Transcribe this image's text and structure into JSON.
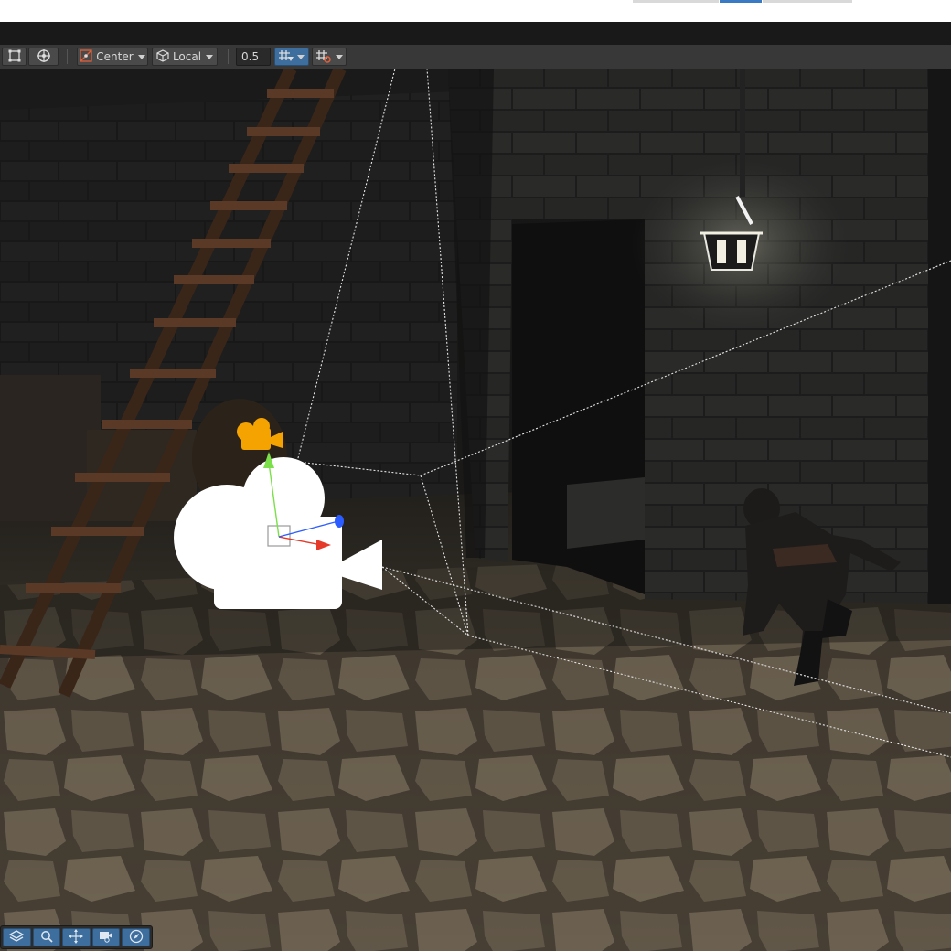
{
  "toolbar": {
    "pivot_label": "Center",
    "space_label": "Local",
    "snap_value": "0.5"
  },
  "icons": {
    "rect_tool": "rect-tool-icon",
    "transform_tool": "transform-tool-icon",
    "pivot": "pivot-icon",
    "local": "local-space-icon",
    "grid_snap": "grid-snap-icon",
    "increment_snap": "increment-snap-icon"
  },
  "overlay": [
    "layers-icon",
    "search-icon",
    "move-icon",
    "camera-preview-icon",
    "compass-icon"
  ],
  "colors": {
    "toolbar_bg": "#383838",
    "accent_blue": "#3d6e9e",
    "camera_gizmo": "#ffffff",
    "camera_icon": "#f5a300",
    "axis_x": "#e53a2a",
    "axis_y": "#7be04a",
    "axis_z": "#2b5cff"
  }
}
